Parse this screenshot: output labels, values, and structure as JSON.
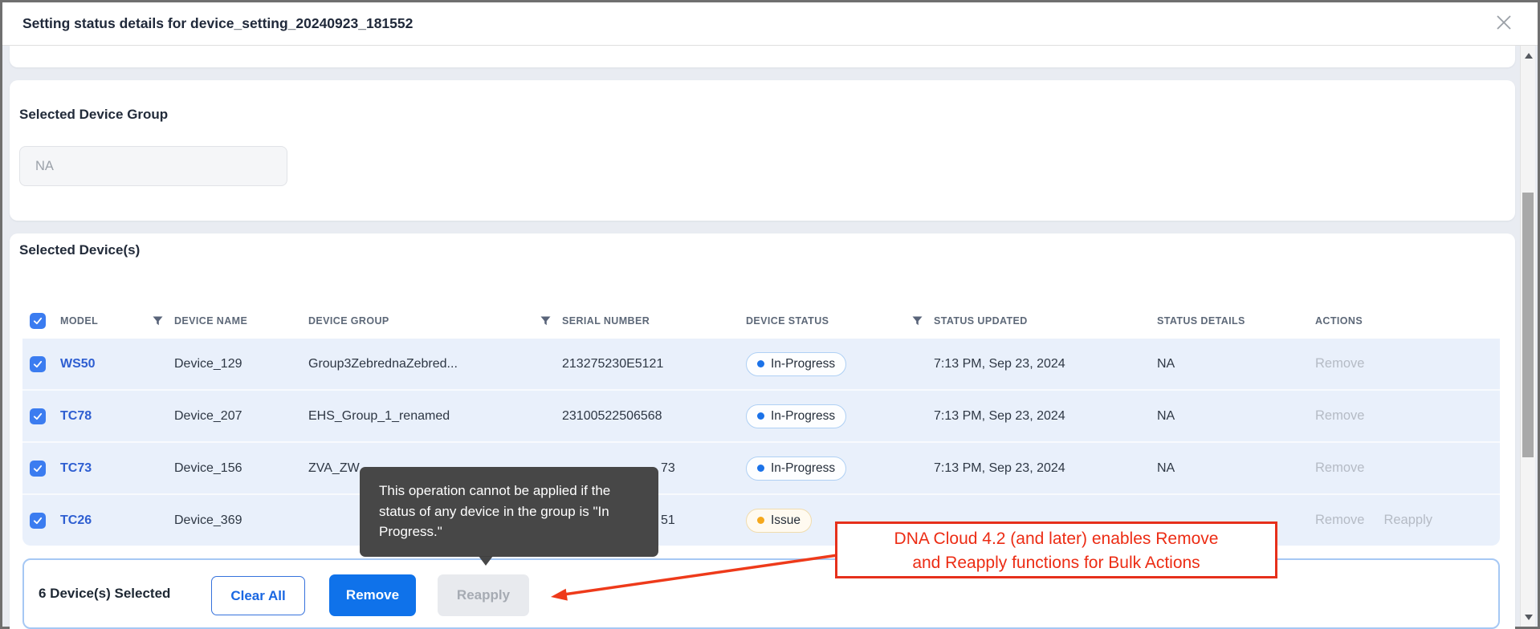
{
  "window": {
    "title": "Setting status details for device_setting_20240923_181552"
  },
  "icons": {
    "close": "x-cross",
    "filter": "funnel",
    "checkbox_check": "check-mark",
    "scroll_up": "triangle-up",
    "scroll_down": "triangle-down"
  },
  "colors": {
    "accent_blue": "#0f72ea",
    "link_blue": "#2e5ed1",
    "status_in_progress_dot": "#1b72e8",
    "status_issue_dot": "#f5a81c",
    "row_selected_bg": "#e9f0fb",
    "annotation_red": "#e6301b",
    "tooltip_bg": "#404040"
  },
  "group_section": {
    "heading": "Selected Device Group",
    "field_value": "NA"
  },
  "devices_section": {
    "heading": "Selected Device(s)"
  },
  "table": {
    "headers": {
      "model": "MODEL",
      "device_name": "DEVICE NAME",
      "device_group": "DEVICE GROUP",
      "serial": "SERIAL NUMBER",
      "device_status": "DEVICE STATUS",
      "status_updated": "STATUS UPDATED",
      "status_details": "STATUS DETAILS",
      "actions": "ACTIONS"
    },
    "rows": [
      {
        "model": "WS50",
        "device_name": "Device_129",
        "device_group": "Group3ZebrednaZebred...",
        "serial": "213275230E5121",
        "status": "In-Progress",
        "status_updated": "7:13 PM, Sep 23, 2024",
        "status_details": "NA",
        "action_remove": "Remove"
      },
      {
        "model": "TC78",
        "device_name": "Device_207",
        "device_group": "EHS_Group_1_renamed",
        "serial": "23100522506568",
        "status": "In-Progress",
        "status_updated": "7:13 PM, Sep 23, 2024",
        "status_details": "NA",
        "action_remove": "Remove"
      },
      {
        "model": "TC73",
        "device_name": "Device_156",
        "device_group": "ZVA_ZW",
        "serial": "73",
        "status": "In-Progress",
        "status_updated": "7:13 PM, Sep 23, 2024",
        "status_details": "NA",
        "action_remove": "Remove"
      },
      {
        "model": "TC26",
        "device_name": "Device_369",
        "device_group": "",
        "serial": "51",
        "status": "Issue",
        "status_updated": "",
        "status_details": "",
        "action_remove": "Remove",
        "action_reapply": "Reapply"
      }
    ]
  },
  "footer": {
    "selected_count": "6 Device(s) Selected",
    "clear_all": "Clear All",
    "remove": "Remove",
    "reapply": "Reapply"
  },
  "tooltip": {
    "text": "This operation cannot be applied if the status of any device in the group is \"In Progress.\""
  },
  "annotation": {
    "line1": "DNA Cloud 4.2 (and later) enables Remove",
    "line2": "and Reapply functions for Bulk Actions"
  }
}
